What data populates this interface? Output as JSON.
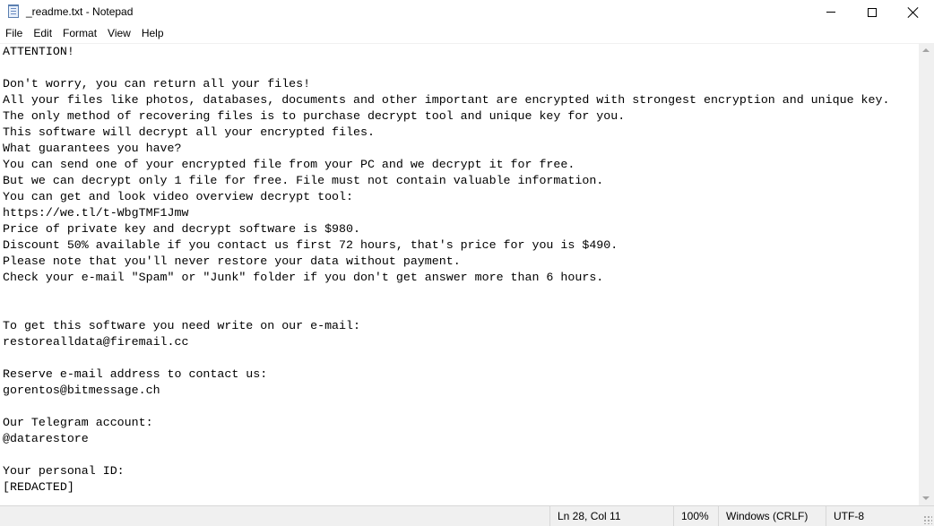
{
  "window": {
    "title": "_readme.txt - Notepad",
    "app_icon": "notepad-icon"
  },
  "controls": {
    "minimize_icon": "minimize-icon",
    "maximize_icon": "maximize-icon",
    "close_icon": "close-icon"
  },
  "menu": {
    "items": [
      "File",
      "Edit",
      "Format",
      "View",
      "Help"
    ]
  },
  "document": {
    "text": "ATTENTION!\n\nDon't worry, you can return all your files!\nAll your files like photos, databases, documents and other important are encrypted with strongest encryption and unique key.\nThe only method of recovering files is to purchase decrypt tool and unique key for you.\nThis software will decrypt all your encrypted files.\nWhat guarantees you have?\nYou can send one of your encrypted file from your PC and we decrypt it for free.\nBut we can decrypt only 1 file for free. File must not contain valuable information.\nYou can get and look video overview decrypt tool:\nhttps://we.tl/t-WbgTMF1Jmw\nPrice of private key and decrypt software is $980.\nDiscount 50% available if you contact us first 72 hours, that's price for you is $490.\nPlease note that you'll never restore your data without payment.\nCheck your e-mail \"Spam\" or \"Junk\" folder if you don't get answer more than 6 hours.\n\n\nTo get this software you need write on our e-mail:\nrestorealldata@firemail.cc\n\nReserve e-mail address to contact us:\ngorentos@bitmessage.ch\n\nOur Telegram account:\n@datarestore\n\nYour personal ID:\n[REDACTED]"
  },
  "status": {
    "position": "Ln 28, Col 11",
    "zoom": "100%",
    "line_ending": "Windows (CRLF)",
    "encoding": "UTF-8"
  },
  "colors": {
    "window_bg": "#ffffff",
    "status_bg": "#f0f0f0",
    "scrollbar_bg": "#f0f0f0"
  }
}
